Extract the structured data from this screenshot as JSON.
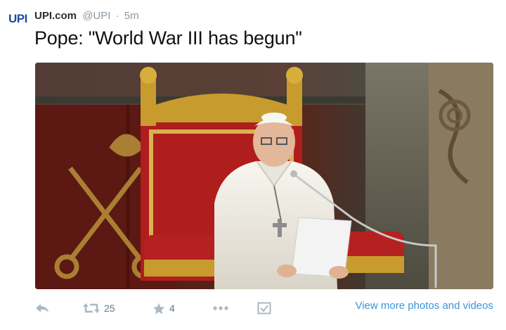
{
  "tweet": {
    "avatar_text": "UPI",
    "fullname": "UPI.com",
    "username": "@UPI",
    "separator": "·",
    "time": "5m",
    "text": "Pope: \"World War III has begun\""
  },
  "actions": {
    "retweet_count": "25",
    "favorite_count": "4"
  },
  "links": {
    "view_more": "View more photos and videos"
  },
  "colors": {
    "brand": "#1b4f9c",
    "link": "#3b94d9",
    "muted": "#8899a6",
    "icon": "#aab8c2"
  },
  "icons": {
    "reply": "reply-icon",
    "retweet": "retweet-icon",
    "favorite": "star-icon",
    "more": "more-dots-icon",
    "summary": "summary-check-icon"
  }
}
